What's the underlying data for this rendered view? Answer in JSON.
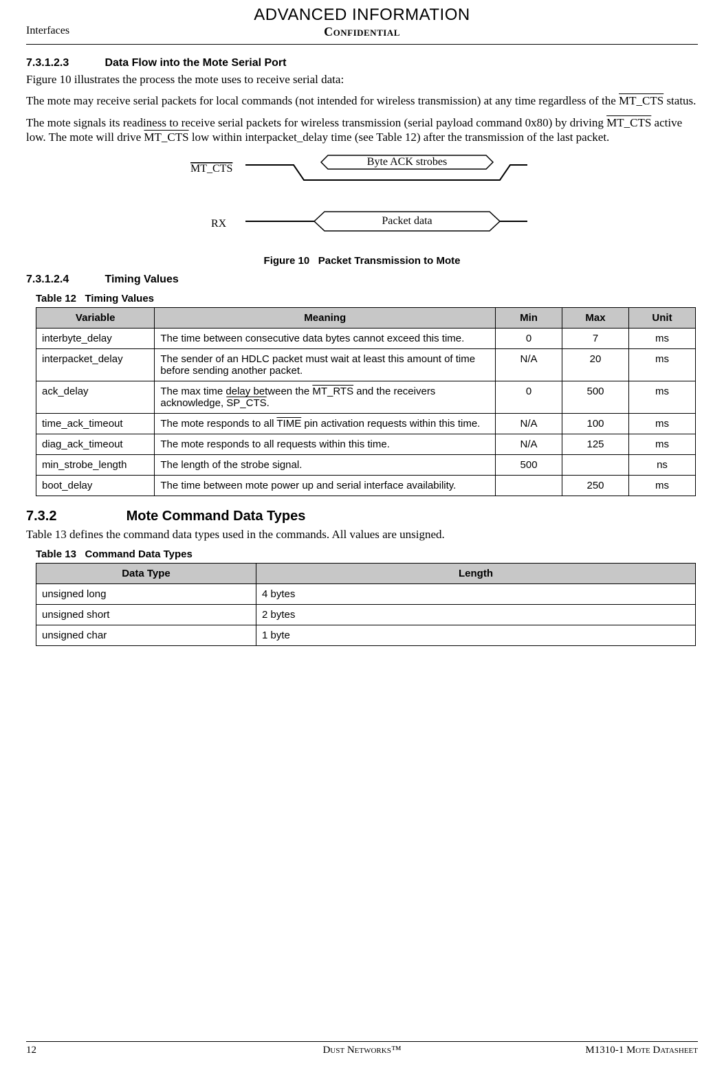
{
  "banner": "ADVANCED INFORMATION",
  "header": {
    "left": "Interfaces",
    "center": "Confidential"
  },
  "sec73123": {
    "num": "7.3.1.2.3",
    "title": "Data Flow into the Mote Serial Port",
    "p1": "Figure 10 illustrates the process the mote uses to receive serial data:",
    "p2a": "The mote may receive serial packets for local commands (not intended for wireless transmission) at any time regardless of the ",
    "p2b": " status.",
    "p3a": "The mote signals its readiness to receive serial packets for wireless transmission (serial payload command 0x80) by driving ",
    "p3b": " active low. The mote will drive ",
    "p3c": " low within interpacket_delay time (see Table 12) after the transmission of the last packet."
  },
  "figure10": {
    "label_mtcts": "MT_CTS",
    "label_rx": "RX",
    "box_ack": "Byte ACK strobes",
    "box_packet": "Packet data",
    "caption_prefix": "Figure 10",
    "caption_text": "Packet Transmission to Mote"
  },
  "sec73124": {
    "num": "7.3.1.2.4",
    "title": "Timing Values"
  },
  "table12": {
    "caption_prefix": "Table 12",
    "caption_text": "Timing Values",
    "headers": {
      "variable": "Variable",
      "meaning": "Meaning",
      "min": "Min",
      "max": "Max",
      "unit": "Unit"
    },
    "rows": [
      {
        "variable": "interbyte_delay",
        "meaning": "The time between consecutive data bytes cannot exceed this time.",
        "min": "0",
        "max": "7",
        "unit": "ms"
      },
      {
        "variable": "interpacket_delay",
        "meaning": "The sender of an HDLC packet must wait at least this amount of time before sending another packet.",
        "min": "N/A",
        "max": "20",
        "unit": "ms"
      },
      {
        "variable": "ack_delay",
        "meaning_pre": "The max time delay between the ",
        "ov1": "MT_RTS",
        "meaning_mid": " and the receivers acknowledge, ",
        "ov2": "SP_CTS",
        "meaning_post": ".",
        "min": "0",
        "max": "500",
        "unit": "ms"
      },
      {
        "variable": "time_ack_timeout",
        "meaning_pre": "The mote responds to all ",
        "ov1": "TIME",
        "meaning_post": " pin activation requests within this time.",
        "min": "N/A",
        "max": "100",
        "unit": "ms"
      },
      {
        "variable": "diag_ack_timeout",
        "meaning": "The mote responds to all requests within this time.",
        "min": "N/A",
        "max": "125",
        "unit": "ms"
      },
      {
        "variable": "min_strobe_length",
        "meaning": "The length of the strobe signal.",
        "min": "500",
        "max": "",
        "unit": "ns"
      },
      {
        "variable": "boot_delay",
        "meaning": "The time between mote power up and serial interface availability.",
        "min": "",
        "max": "250",
        "unit": "ms"
      }
    ]
  },
  "sec732": {
    "num": "7.3.2",
    "title": "Mote Command Data Types",
    "p1": "Table 13 defines the command data types used in the commands. All values are unsigned."
  },
  "table13": {
    "caption_prefix": "Table 13",
    "caption_text": "Command Data Types",
    "headers": {
      "datatype": "Data Type",
      "length": "Length"
    },
    "rows": [
      {
        "datatype": "unsigned long",
        "length": "4 bytes"
      },
      {
        "datatype": "unsigned short",
        "length": "2 bytes"
      },
      {
        "datatype": "unsigned char",
        "length": "1 byte"
      }
    ]
  },
  "footer": {
    "left": "12",
    "center": "Dust Networks™",
    "right": "M1310-1 Mote Datasheet"
  }
}
